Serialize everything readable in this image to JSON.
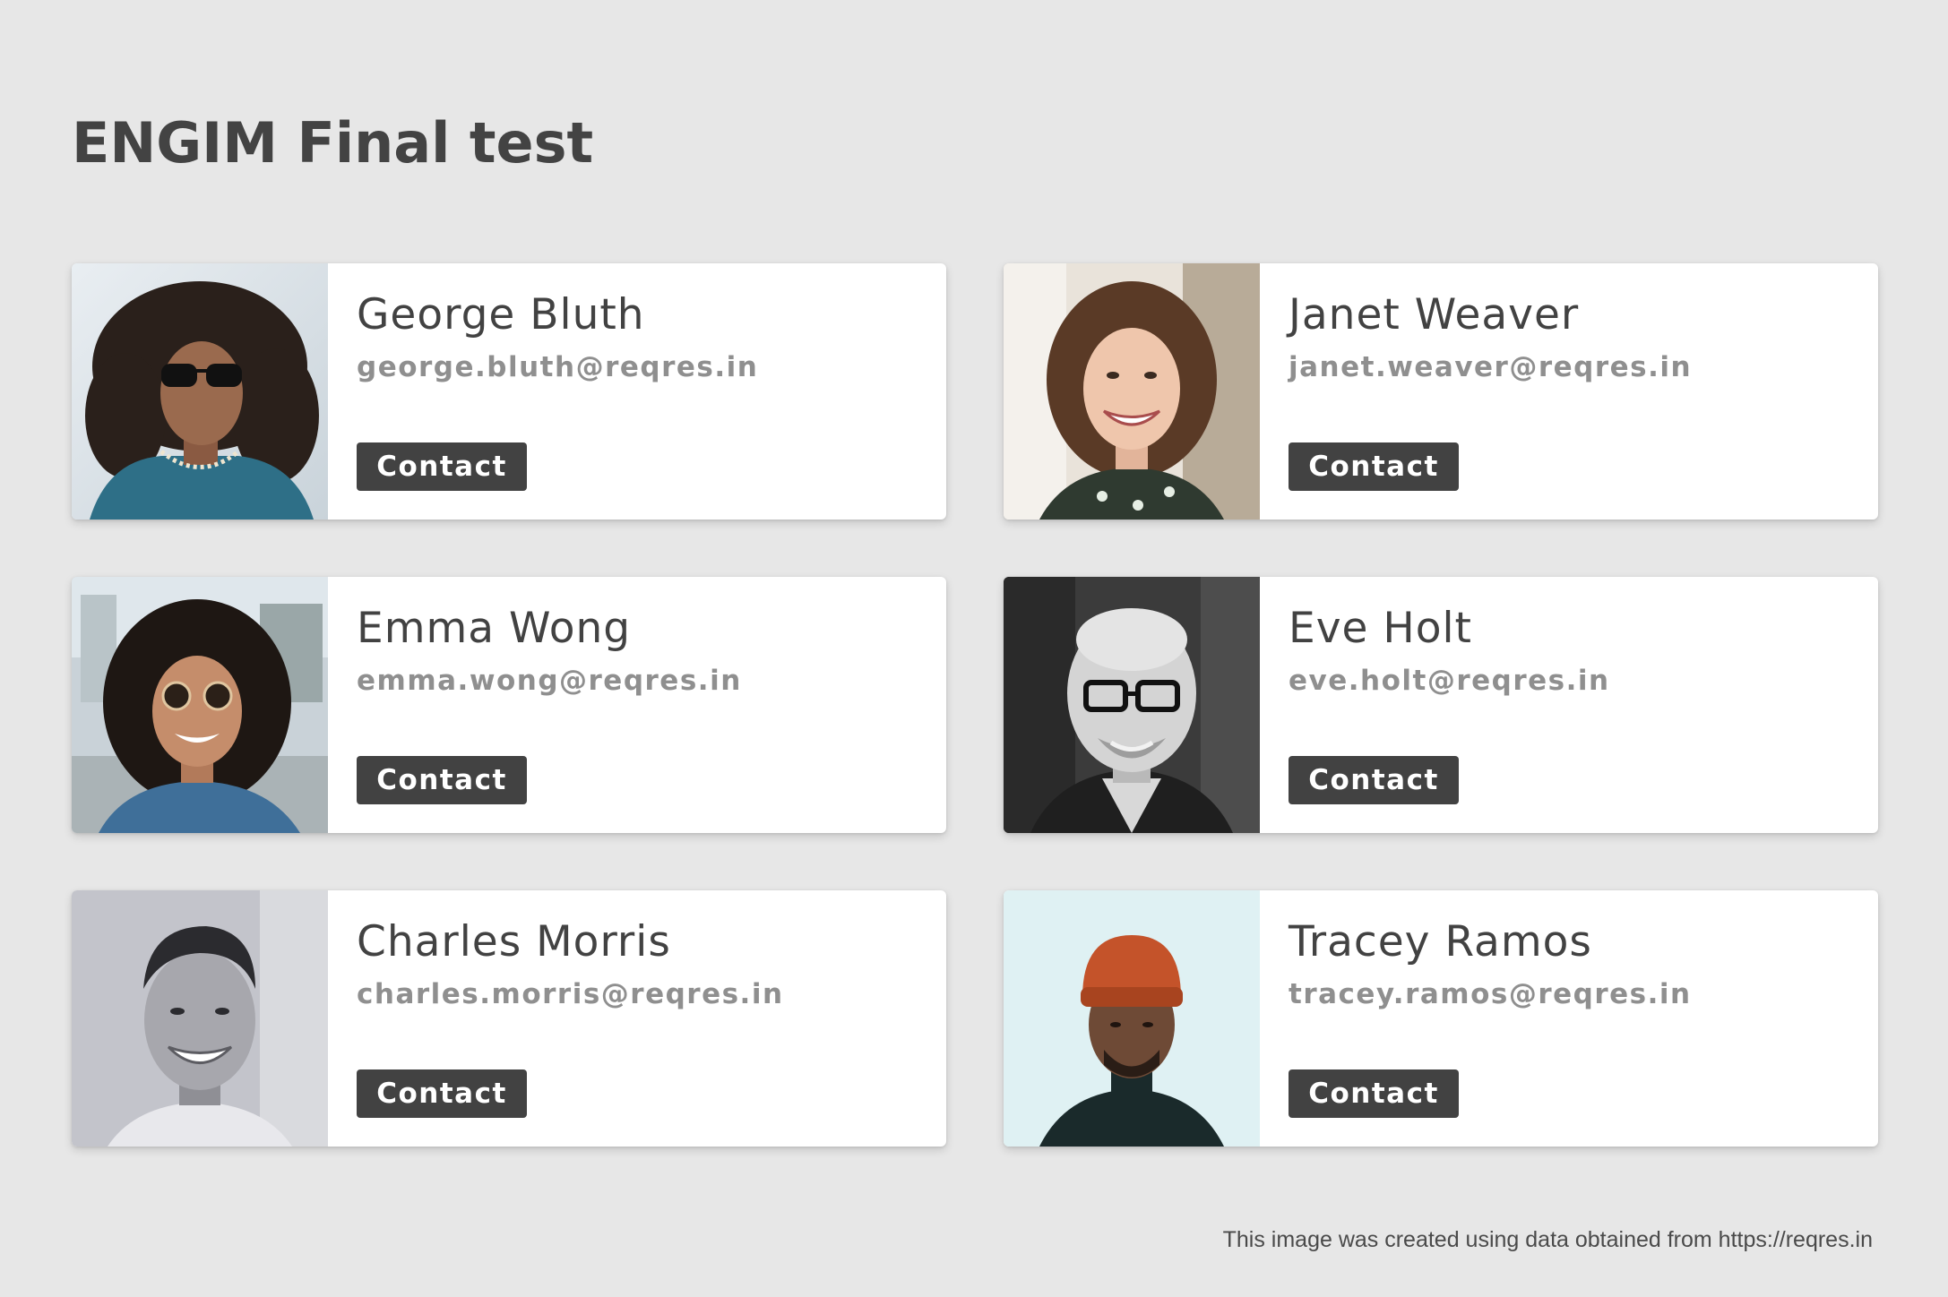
{
  "page": {
    "title": "ENGIM Final test",
    "footer": "This image was created using data obtained from https://reqres.in"
  },
  "users": [
    {
      "name": "George Bluth",
      "email": "george.bluth@reqres.in",
      "button": "Contact",
      "photo": "portrait-man-curly-hair-sunglasses"
    },
    {
      "name": "Janet Weaver",
      "email": "janet.weaver@reqres.in",
      "button": "Contact",
      "photo": "portrait-woman-smiling-wavy-hair"
    },
    {
      "name": "Emma Wong",
      "email": "emma.wong@reqres.in",
      "button": "Contact",
      "photo": "portrait-woman-curly-hair-sunglasses"
    },
    {
      "name": "Eve Holt",
      "email": "eve.holt@reqres.in",
      "button": "Contact",
      "photo": "portrait-bald-man-glasses-bw"
    },
    {
      "name": "Charles Morris",
      "email": "charles.morris@reqres.in",
      "button": "Contact",
      "photo": "portrait-man-smiling-bw"
    },
    {
      "name": "Tracey Ramos",
      "email": "tracey.ramos@reqres.in",
      "button": "Contact",
      "photo": "portrait-man-orange-beanie"
    }
  ],
  "colors": {
    "background": "#e7e7e7",
    "card": "#ffffff",
    "button": "#424242",
    "name_text": "#424242",
    "email_text": "#8f8f8f"
  }
}
